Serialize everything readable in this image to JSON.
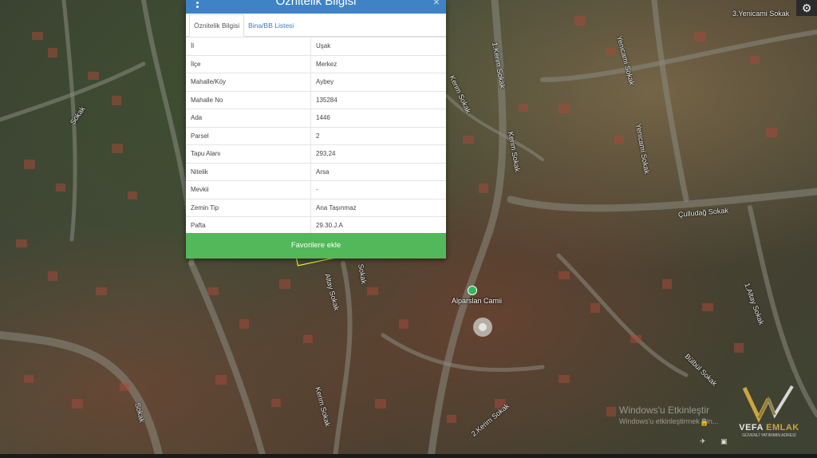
{
  "map": {
    "street_labels": [
      {
        "text": "3.Yenicami Sokak",
        "rot": 0
      },
      {
        "text": "Yenicami Sokak",
        "rot": 0
      },
      {
        "text": "1.Kerim Sokak",
        "rot": 80
      },
      {
        "text": "Kerim Sokak",
        "rot": 65
      },
      {
        "text": "Kerim Sokak",
        "rot": 80
      },
      {
        "text": "Sokak",
        "rot": -55
      },
      {
        "text": "Yenicami Sokak",
        "rot": 80
      },
      {
        "text": "Çulludağ Sokak",
        "rot": -5
      },
      {
        "text": "Sokak",
        "rot": 80
      },
      {
        "text": "Altay Sokak",
        "rot": 75
      },
      {
        "text": "Kerim Sokak",
        "rot": 75
      },
      {
        "text": "2.Kerim Sokak",
        "rot": -40
      },
      {
        "text": "Sokak",
        "rot": 75
      },
      {
        "text": "Bülbül Sokak",
        "rot": 45
      },
      {
        "text": "1.Altay Sokak",
        "rot": 70
      }
    ],
    "poi": {
      "label": "Alparslan Camii"
    }
  },
  "panel": {
    "title": "Öznitelik Bilgisi",
    "tabs": [
      {
        "label": "Öznitelik Bilgisi",
        "active": true
      },
      {
        "label": "Bina/BB Listesi",
        "active": false
      }
    ],
    "rows": [
      {
        "key": "İl",
        "value": "Uşak"
      },
      {
        "key": "İlçe",
        "value": "Merkez"
      },
      {
        "key": "Mahalle/Köy",
        "value": "Aybey"
      },
      {
        "key": "Mahalle No",
        "value": "135284"
      },
      {
        "key": "Ada",
        "value": "1446"
      },
      {
        "key": "Parsel",
        "value": "2"
      },
      {
        "key": "Tapu Alanı",
        "value": "293,24"
      },
      {
        "key": "Nitelik",
        "value": "Arsa"
      },
      {
        "key": "Mevkii",
        "value": "-"
      },
      {
        "key": "Zemin Tip",
        "value": "Ana Taşınmaz"
      },
      {
        "key": "Pafta",
        "value": "29.30.J.A"
      }
    ],
    "favorite_label": "Favorilere ekle"
  },
  "watermark": {
    "title": "Windows'u Etkinleştir",
    "subtitle": "Windows'u etkinleştirmek için..."
  },
  "logo": {
    "name_part1": "VEFA ",
    "name_part2": "EMLAK",
    "tagline": "GÜVENLİ YATIRIMIN ADRESİ"
  },
  "colors": {
    "panel_header": "#3f83c6",
    "favorite_button": "#52b85a",
    "tab_link": "#3b7cc0"
  }
}
